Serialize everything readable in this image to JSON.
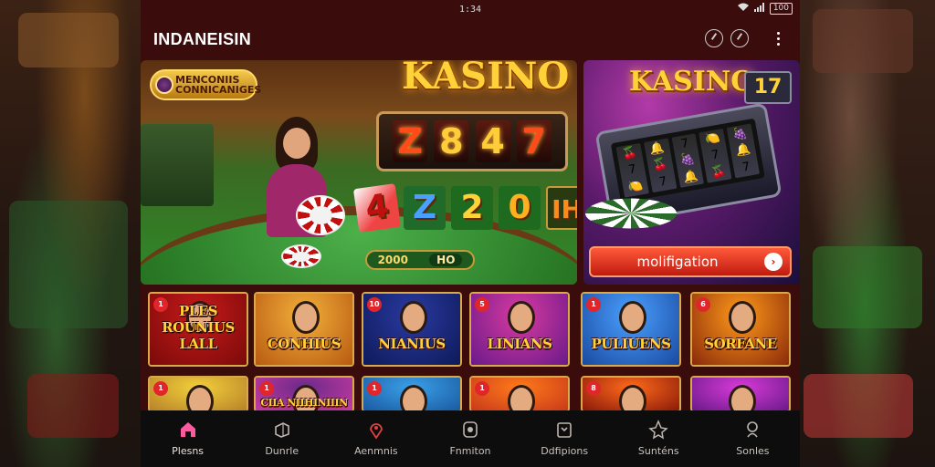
{
  "status_bar": {
    "time": "1:34",
    "battery": "100"
  },
  "app_bar": {
    "title": "INDANEISIN"
  },
  "hero_main": {
    "welcome_badge": "MENCONIIS CONNICANIGES",
    "title": "KASINO",
    "reel_digits": [
      "Z",
      "8",
      "4",
      "7"
    ],
    "number_tiles": [
      "4",
      "Z",
      "2",
      "0",
      "IH"
    ],
    "bet_values": [
      "2000",
      "HO"
    ]
  },
  "hero_side": {
    "title": "KASINO",
    "badge_number": "17",
    "cta_label": "molifigation"
  },
  "games": [
    {
      "num": "1",
      "title": "PLES ROUNIUS LALL",
      "colors": [
        "#c81a1a",
        "#7a0a0a"
      ]
    },
    {
      "num": "",
      "title": "CONHIUS",
      "colors": [
        "#f2b03a",
        "#b85a12"
      ]
    },
    {
      "num": "10",
      "title": "NIANIUS",
      "colors": [
        "#2a3aa0",
        "#0e1a5a"
      ]
    },
    {
      "num": "5",
      "title": "LINIANS",
      "colors": [
        "#d83aa0",
        "#6a1a8a"
      ]
    },
    {
      "num": "1",
      "title": "PULIUENS",
      "colors": [
        "#4aa0ff",
        "#1a4aa0"
      ]
    },
    {
      "num": "6",
      "title": "SORFANE",
      "colors": [
        "#ff9a1a",
        "#8a2a0a"
      ]
    },
    {
      "num": "1",
      "title": "",
      "colors": [
        "#f2d03a",
        "#b8822a"
      ]
    },
    {
      "num": "1",
      "title": "CIIA NIIHINIIIN",
      "colors": [
        "#6a2a8a",
        "#c83aa0"
      ]
    },
    {
      "num": "1",
      "title": "",
      "colors": [
        "#3aa0e8",
        "#1a5aa0"
      ]
    },
    {
      "num": "1",
      "title": "",
      "colors": [
        "#ff7a1a",
        "#c83a1a"
      ]
    },
    {
      "num": "8",
      "title": "",
      "colors": [
        "#ff6a1a",
        "#8a1a0a"
      ]
    },
    {
      "num": "",
      "title": "",
      "colors": [
        "#d83ad8",
        "#6a1a8a"
      ]
    }
  ],
  "bottom_nav": [
    {
      "label": "Plesns",
      "icon": "home-icon",
      "active": true
    },
    {
      "label": "Dunrle",
      "icon": "dice-icon",
      "active": false
    },
    {
      "label": "Aenmnis",
      "icon": "location-icon",
      "active": false
    },
    {
      "label": "Fnmiton",
      "icon": "card-icon",
      "active": false
    },
    {
      "label": "Ddfipions",
      "icon": "calendar-icon",
      "active": false
    },
    {
      "label": "Sunténs",
      "icon": "star-icon",
      "active": false
    },
    {
      "label": "Sonles",
      "icon": "search-icon",
      "active": false
    }
  ],
  "colors": {
    "accent": "#ff5aa0",
    "app_bg": "#3a0c0c",
    "nav_bg": "#0e0d0d",
    "cta": "#e03020"
  }
}
